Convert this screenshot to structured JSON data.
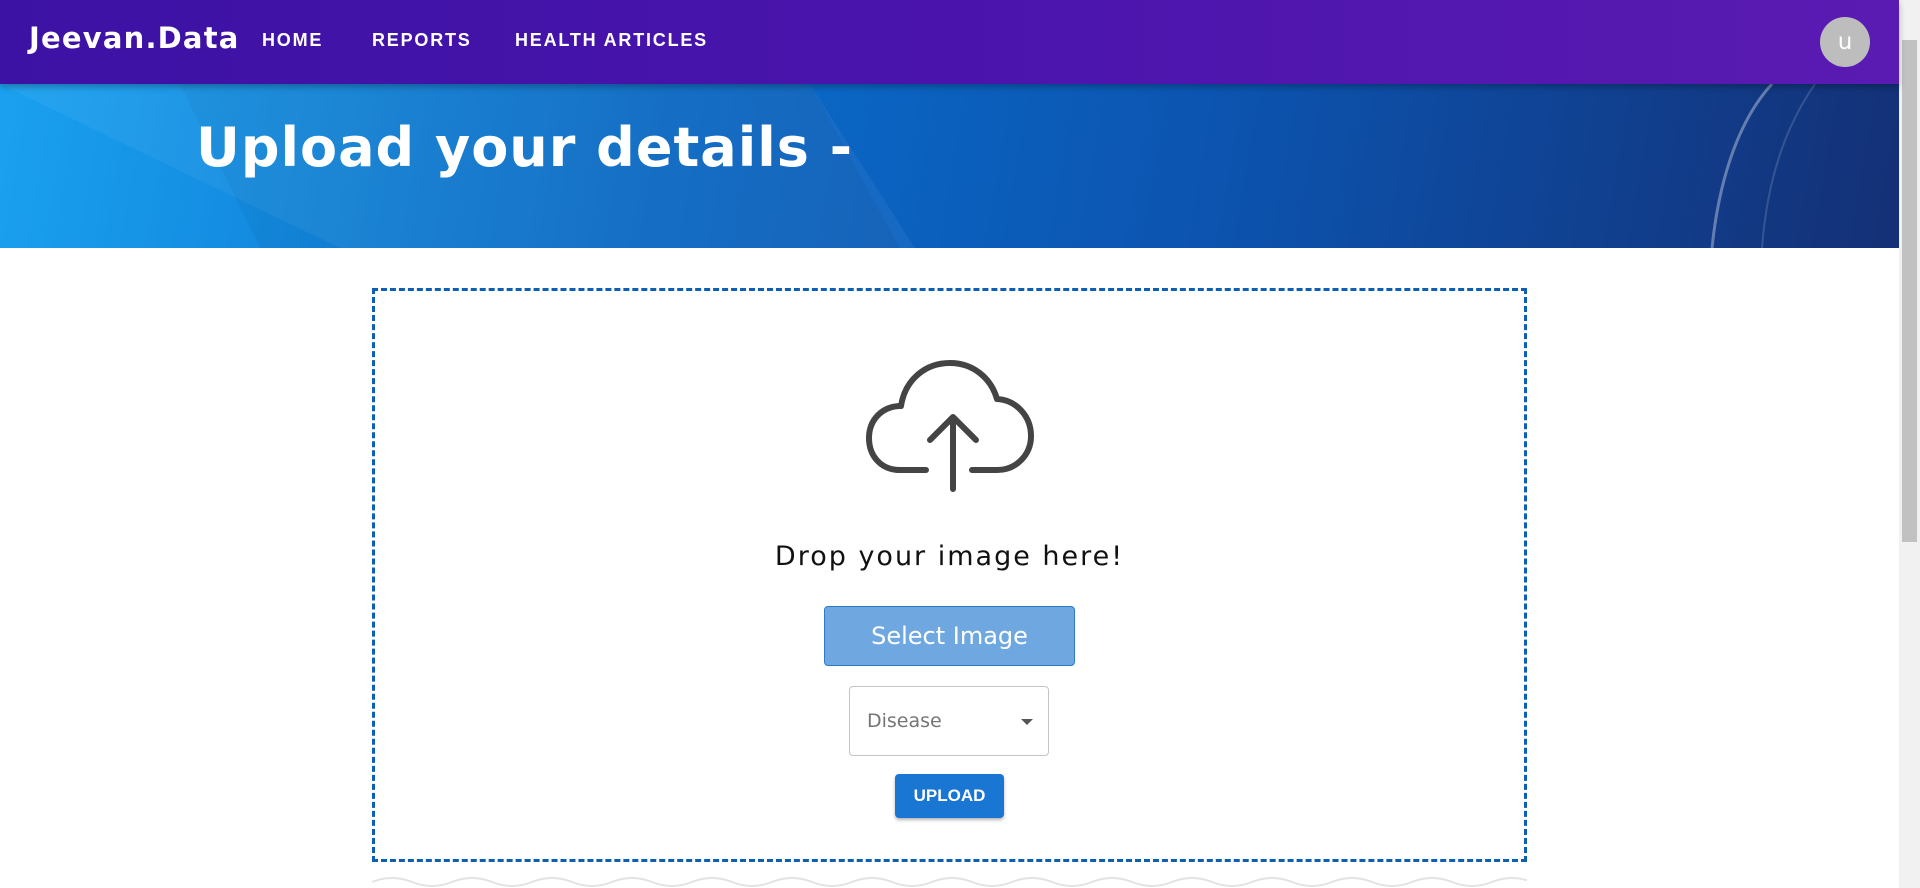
{
  "navbar": {
    "brand": "Jeevan.Data",
    "links": [
      {
        "label": "HOME"
      },
      {
        "label": "REPORTS"
      },
      {
        "label": "HEALTH ARTICLES"
      }
    ],
    "avatar_initial": "u",
    "background_color": "#4a14ac"
  },
  "hero": {
    "title": "Upload your details -"
  },
  "upload": {
    "icon": "cloud-upload-icon",
    "drop_text": "Drop your image here!",
    "select_button_label": "Select Image",
    "disease_select": {
      "placeholder": "Disease",
      "icon": "caret-down-icon"
    },
    "upload_button_label": "UPLOAD",
    "border_color": "#0d5fb4",
    "button_color": "#1976d2"
  }
}
